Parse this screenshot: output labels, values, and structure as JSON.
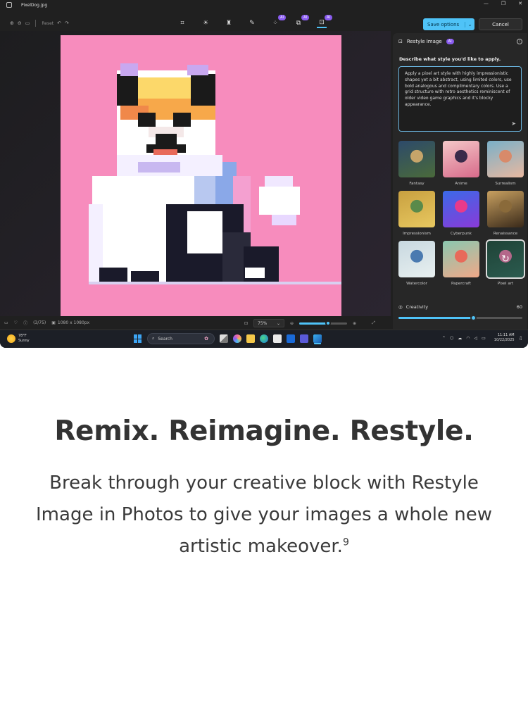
{
  "window": {
    "file_name": "PixelDog.jpg"
  },
  "toolbar": {
    "reset_label": "Reset",
    "ai_badge": "AI",
    "save_label": "Save options",
    "cancel_label": "Cancel"
  },
  "panel": {
    "title": "Restyle Image",
    "ai_badge": "AI",
    "question": "Describe what style you'd like to apply.",
    "prompt": "Apply a pixel art style with highly impressionistic shapes yet a bit abstract, using limited colors, use bold analogous and complimentary colors. Use a grid structure with retro aesthetics reminiscent of older video game graphics and it's blocky appearance.",
    "styles": [
      {
        "name": "Fantasy",
        "colors": [
          "#4a6a3a",
          "#c6a56a",
          "#2d4a6a"
        ]
      },
      {
        "name": "Anime",
        "colors": [
          "#d86a8a",
          "#3a2a4a",
          "#f4c8c8"
        ]
      },
      {
        "name": "Surrealism",
        "colors": [
          "#e8b8a0",
          "#d88a6a",
          "#7ab0c8"
        ]
      },
      {
        "name": "Impressionism",
        "colors": [
          "#e8c860",
          "#5a8a4a",
          "#c8a040"
        ]
      },
      {
        "name": "Cyberpunk",
        "colors": [
          "#8a3ad8",
          "#e83a8a",
          "#3a6ae8"
        ]
      },
      {
        "name": "Renaissance",
        "colors": [
          "#3a2a1a",
          "#8a6a3a",
          "#c8a060"
        ]
      },
      {
        "name": "Watercolor",
        "colors": [
          "#e8f0f0",
          "#4a7ab0",
          "#c8d8e0"
        ]
      },
      {
        "name": "Papercraft",
        "colors": [
          "#f0a888",
          "#e86a5a",
          "#8ac8b0"
        ]
      },
      {
        "name": "Pixel art",
        "colors": [
          "#3a7a6a",
          "#f08ab8",
          "#2a5a4a"
        ],
        "selected": true
      }
    ],
    "creativity": {
      "label": "Creativity",
      "value": 60,
      "fraction": 0.6
    }
  },
  "statusbar": {
    "index": "(3/75)",
    "dimensions": "1080 x 1080px",
    "zoom": "75%",
    "zoom_fraction": 0.6
  },
  "taskbar": {
    "temperature": "78°F",
    "condition": "Sunny",
    "search_label": "Search",
    "time": "11:11 AM",
    "date": "10/22/2025"
  },
  "marketing": {
    "headline": "Remix. Reimagine. Restyle.",
    "description": "Break through your creative block with Restyle Image in Photos to give your images a whole new artistic makeover.",
    "footnote": "9"
  }
}
